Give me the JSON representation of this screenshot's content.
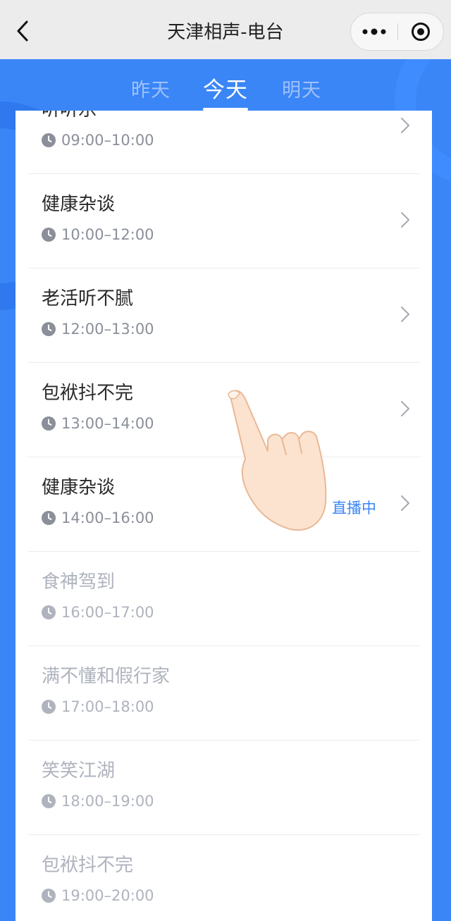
{
  "header": {
    "title": "天津相声-电台"
  },
  "tabs": [
    {
      "label": "昨天",
      "active": false
    },
    {
      "label": "今天",
      "active": true
    },
    {
      "label": "明天",
      "active": false
    }
  ],
  "schedule": [
    {
      "name": "听听乐",
      "time": "09:00–10:00",
      "state": "past"
    },
    {
      "name": "健康杂谈",
      "time": "10:00–12:00",
      "state": "past"
    },
    {
      "name": "老活听不腻",
      "time": "12:00–13:00",
      "state": "past"
    },
    {
      "name": "包袱抖不完",
      "time": "13:00–14:00",
      "state": "past"
    },
    {
      "name": "健康杂谈",
      "time": "14:00–16:00",
      "state": "live",
      "live_label": "直播中"
    },
    {
      "name": "食神驾到",
      "time": "16:00–17:00",
      "state": "upcoming"
    },
    {
      "name": "满不懂和假行家",
      "time": "17:00–18:00",
      "state": "upcoming"
    },
    {
      "name": "笑笑江湖",
      "time": "18:00–19:00",
      "state": "upcoming"
    },
    {
      "name": "包袱抖不完",
      "time": "19:00–20:00",
      "state": "upcoming"
    }
  ],
  "colors": {
    "accent": "#3a86f7",
    "text_primary": "#2a2a2a",
    "text_muted": "#8a8f99",
    "text_disabled": "#aeb3bd"
  }
}
